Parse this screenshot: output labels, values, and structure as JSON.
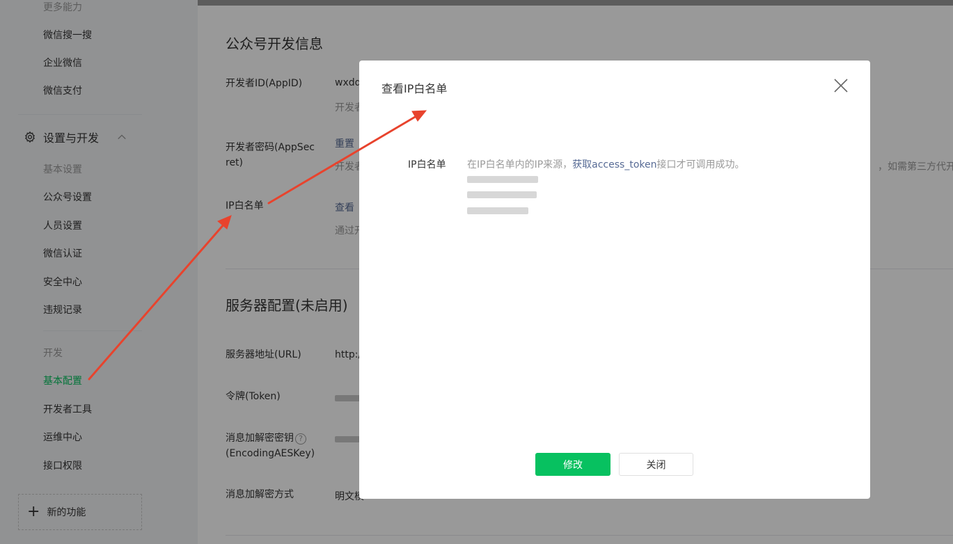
{
  "sidebar": {
    "top_items": [
      "更多能力",
      "微信搜一搜",
      "企业微信",
      "微信支付"
    ],
    "group_title": "设置与开发",
    "settings_header": "基本设置",
    "settings_items": [
      "公众号设置",
      "人员设置",
      "微信认证",
      "安全中心",
      "违规记录"
    ],
    "dev_header": "开发",
    "dev_items": [
      "基本配置",
      "开发者工具",
      "运维中心",
      "接口权限"
    ],
    "new_feature": "新的功能"
  },
  "main": {
    "dev_info_title": "公众号开发信息",
    "appid_label": "开发者ID(AppID)",
    "appid_value": "wxdd",
    "appid_desc": "开发者",
    "secret_label_1": "开发者密码(AppSec",
    "secret_label_2": "ret)",
    "secret_reset": "重置",
    "secret_desc": "开发者",
    "secret_desc_right": "，如需第三方代开发",
    "ip_label": "IP白名单",
    "ip_view": "查看",
    "ip_desc": "通过开",
    "server_title": "服务器配置(未启用)",
    "url_label": "服务器地址(URL)",
    "url_value": "http:/",
    "token_label": "令牌(Token)",
    "aes_label_1": "消息加解密密钥",
    "aes_label_2": "(EncodingAESKey)",
    "aes_help": "?",
    "mode_label": "消息加解密方式",
    "mode_value": "明文模"
  },
  "dialog": {
    "title": "查看IP白名单",
    "field_label": "IP白名单",
    "desc_before": "在IP白名单内的IP来源，",
    "desc_link": "获取access_token",
    "desc_after": "接口才可调用成功。",
    "ok_label": "修改",
    "close_label": "关闭"
  },
  "colors": {
    "accent": "#07c160",
    "link": "#576b95",
    "arrow": "#e8432d"
  }
}
